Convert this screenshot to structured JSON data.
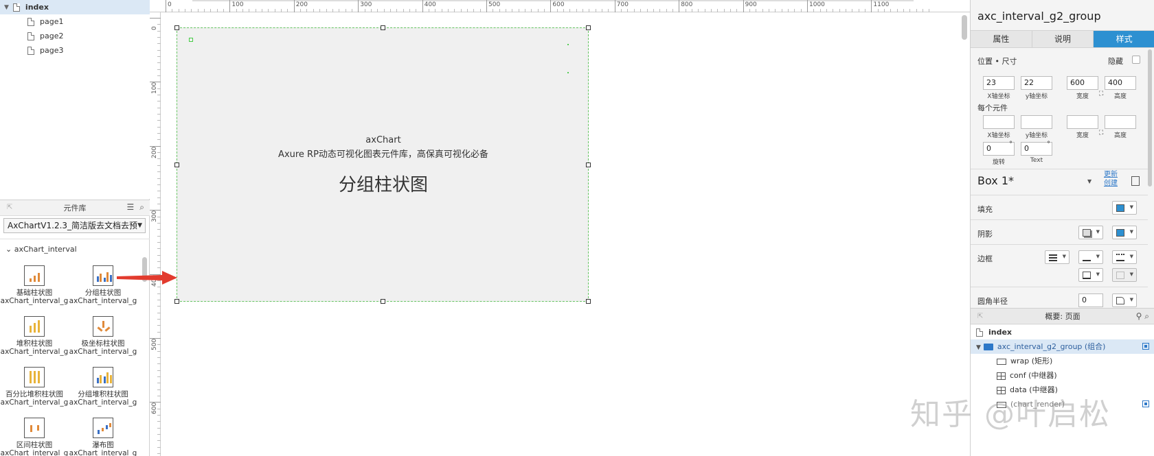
{
  "pages": {
    "index": "index",
    "children": [
      "page1",
      "page2",
      "page3"
    ]
  },
  "library": {
    "header": "元件库",
    "selected": "AxChartV1.2.3_简洁版去文档去预",
    "group": "axChart_interval",
    "widgets": [
      {
        "name": "基础柱状图",
        "id": "axChart_interval_g"
      },
      {
        "name": "分组柱状图",
        "id": "axChart_interval_g"
      },
      {
        "name": "堆积柱状图",
        "id": "axChart_interval_g"
      },
      {
        "name": "极坐标柱状图",
        "id": "axChart_interval_g"
      },
      {
        "name": "百分比堆积柱状图",
        "id": "axChart_interval_g"
      },
      {
        "name": "分组堆积柱状图",
        "id": "axChart_interval_g"
      },
      {
        "name": "区间柱状图",
        "id": "axChart_interval_g"
      },
      {
        "name": "瀑布图",
        "id": "axChart_interval_g"
      }
    ]
  },
  "ruler": {
    "top": [
      "0",
      "100",
      "200",
      "300",
      "400",
      "500",
      "600",
      "700",
      "800",
      "900",
      "1000",
      "1100"
    ],
    "left": [
      "0",
      "100",
      "200",
      "300",
      "400",
      "500",
      "600"
    ]
  },
  "canvas": {
    "line1": "axChart",
    "line2": "Axure RP动态可视化图表元件库，高保真可视化必备",
    "title": "分组柱状图"
  },
  "inspector": {
    "name": "axc_interval_g2_group",
    "tabs": [
      "属性",
      "说明",
      "样式"
    ],
    "active_tab": "样式",
    "position_label": "位置 • 尺寸",
    "hidden_label": "隐藏",
    "x": "23",
    "y": "22",
    "w": "600",
    "h": "400",
    "x_label": "X轴坐标",
    "y_label": "y轴坐标",
    "w_label": "宽度",
    "h_label": "高度",
    "each_label": "每个元件",
    "rotate": "0",
    "text_rotate": "0",
    "rotate_label": "旋转",
    "text_label": "Text",
    "style_name": "Box 1*",
    "update": "更新",
    "create": "创建",
    "fill_label": "填充",
    "shadow_label": "阴影",
    "border_label": "边框",
    "radius_label": "圆角半径",
    "radius": "0",
    "fill_color": "#2d90d1"
  },
  "outline": {
    "header": "概要: 页面",
    "items": [
      {
        "label": "index"
      },
      {
        "label": "axc_interval_g2_group (组合)"
      },
      {
        "label": "wrap (矩形)"
      },
      {
        "label": "conf (中继器)"
      },
      {
        "label": "data (中继器)"
      },
      {
        "label": "(chart_render)"
      }
    ]
  },
  "watermark": "知乎 @叶启松"
}
